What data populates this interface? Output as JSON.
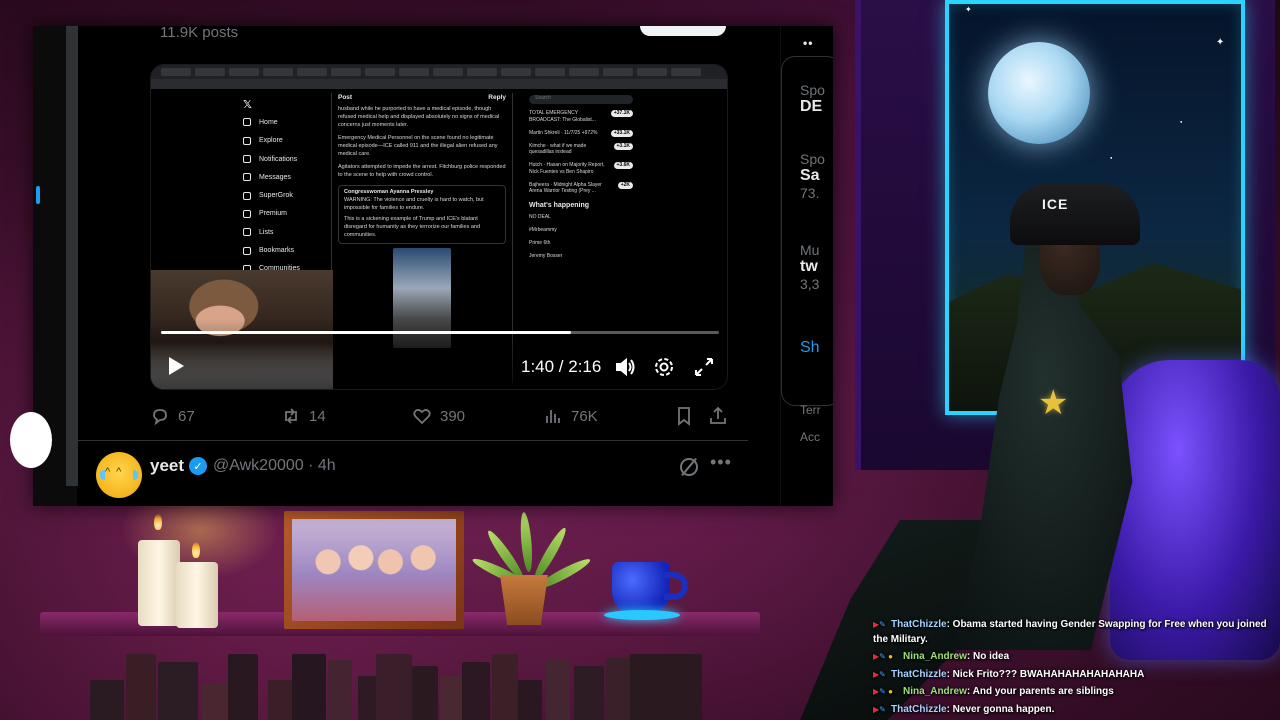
{
  "profile": {
    "posts_count": "11.9K posts"
  },
  "video": {
    "time": "1:40 / 2:16",
    "progress": 0.735,
    "screen_post": {
      "header": "Post",
      "reply_button": "Reply",
      "paragraph_1": "husband while he purported to have a medical episode, though refused medical help and displayed absolutely no signs of medical concerns just moments later.",
      "paragraph_2": "Emergency Medical Personnel on the scene found no legitimate medical episode—ICE called 911 and the illegal alien refused any medical care.",
      "paragraph_3": "Agitators attempted to impede the arrest. Fitchburg police responded to the scene to help with crowd control.",
      "quote_author": "Congresswoman Ayanna Pressley",
      "quote_line_1": "WARNING: The violence and cruelty is hard to watch, but impossible for families to endure.",
      "quote_line_2": "This is a sickening example of Trump and ICE's blatant disregard for humanity as they terrorize our families and communities."
    },
    "screen_nav": [
      "Home",
      "Explore",
      "Notifications",
      "Messages",
      "SuperGrok",
      "Premium",
      "Lists",
      "Bookmarks",
      "Communities"
    ],
    "screen_side": {
      "search": "Search",
      "rows": [
        {
          "title": "TOTAL EMERGENCY BROADCAST: The Globalist...",
          "badge": "+37.1K"
        },
        {
          "title": "Martin Shkreli · 11/7/25 +972%",
          "badge": "+33.1K"
        },
        {
          "title": "Kimche · what if we made quesadillas instead",
          "badge": "+3.1K"
        },
        {
          "title": "Hutch · Hasan on Majority Report, Nick Fuentes vs Ben Shapiro",
          "badge": "+3.6K"
        },
        {
          "title": "Bajheera · Midnight Alpha Slayer Arena Warrior Testing (Prey ...",
          "badge": "+2K"
        }
      ],
      "whats_happening": "What's happening",
      "trends": [
        "NO DEAL",
        "#Mrbeammy",
        "Prime 6th",
        "Jeremy Bosser"
      ]
    }
  },
  "actions": {
    "replies": "67",
    "reposts": "14",
    "likes": "390",
    "views": "76K"
  },
  "tweet2": {
    "name": "yeet",
    "handle": "@Awk20000 · 4h"
  },
  "right_column": {
    "items": [
      {
        "label": "Spo",
        "title": "DE"
      },
      {
        "label": "Spo",
        "title": "Sa",
        "sub": "73."
      },
      {
        "label": "Mu",
        "title": "tw",
        "sub": "3,3"
      }
    ],
    "link": "Sh",
    "footer_1": "Terr",
    "footer_2": "Acc"
  },
  "overlay": {
    "cap_text": "ICE"
  },
  "chat": [
    {
      "user": "ThatChizzle",
      "color": "#a7d3ff",
      "text": ": Obama started having Gender Swapping for Free when you joined the Military."
    },
    {
      "user": "Nina_Andrew",
      "color": "#9de07a",
      "text": ": No idea"
    },
    {
      "user": "ThatChizzle",
      "color": "#a7d3ff",
      "text": ": Nick Frito??? BWAHAHAHAHAHAHAHA"
    },
    {
      "user": "Nina_Andrew",
      "color": "#9de07a",
      "text": ": And your parents are siblings"
    },
    {
      "user": "ThatChizzle",
      "color": "#a7d3ff",
      "text": ": Never gonna happen."
    }
  ]
}
